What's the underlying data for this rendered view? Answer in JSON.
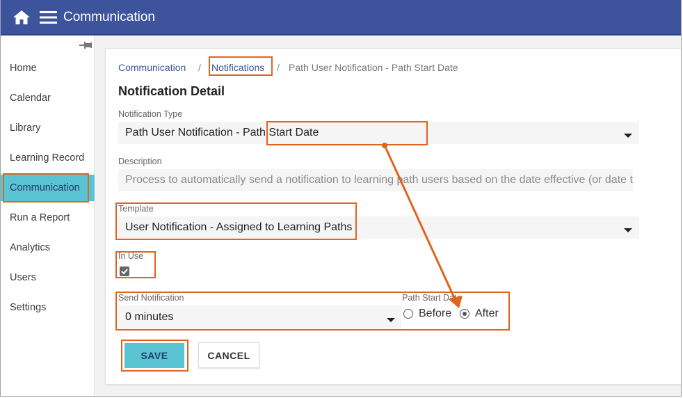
{
  "header": {
    "title": "Communication"
  },
  "sidebar": {
    "items": [
      {
        "label": "Home"
      },
      {
        "label": "Calendar"
      },
      {
        "label": "Library"
      },
      {
        "label": "Learning Record"
      },
      {
        "label": "Communication",
        "active": true
      },
      {
        "label": "Run a Report"
      },
      {
        "label": "Analytics"
      },
      {
        "label": "Users"
      },
      {
        "label": "Settings"
      }
    ]
  },
  "breadcrumb": {
    "root": "Communication",
    "section": "Notifications",
    "current": "Path User Notification - Path Start Date",
    "separator": "/"
  },
  "detail": {
    "heading": "Notification Detail",
    "notification_type": {
      "label": "Notification Type",
      "value": "Path User Notification - Path Start Date"
    },
    "description": {
      "label": "Description",
      "value": "Process to automatically send a notification to learning path users based on the date effective (or date t"
    },
    "template": {
      "label": "Template",
      "value": "User Notification - Assigned to Learning Paths"
    },
    "in_use": {
      "label": "In Use",
      "checked": true
    },
    "send_notification": {
      "label": "Send Notification",
      "value": "0 minutes"
    },
    "path_start_date": {
      "label": "Path Start Date",
      "options": [
        "Before",
        "After"
      ],
      "selected": "After"
    }
  },
  "buttons": {
    "save": "SAVE",
    "cancel": "CANCEL"
  },
  "colors": {
    "topbar": "#3d539c",
    "accent": "#5bc4d3",
    "highlight": "#e0641c"
  }
}
